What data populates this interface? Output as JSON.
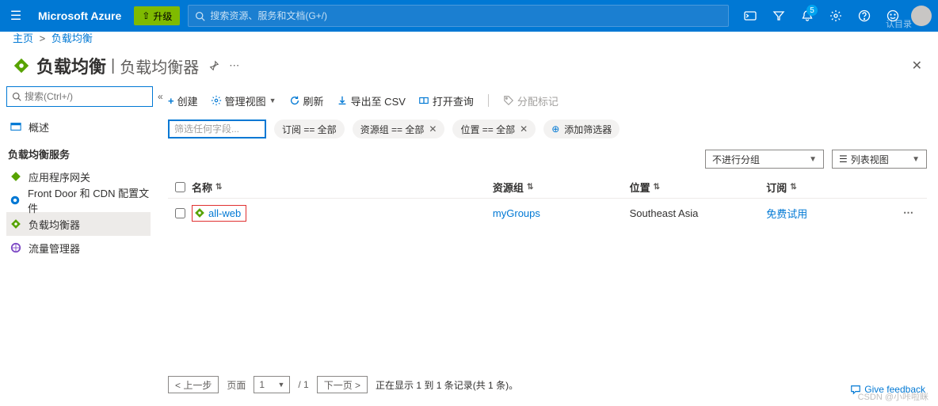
{
  "topbar": {
    "brand": "Microsoft Azure",
    "upgrade": "升级",
    "search_placeholder": "搜索资源、服务和文档(G+/)",
    "notif_count": "5"
  },
  "breadcrumb": {
    "home": "主页",
    "current": "负载均衡"
  },
  "header": {
    "title": "负载均衡",
    "subtitle": "负载均衡器"
  },
  "sidebar": {
    "search_placeholder": "搜索(Ctrl+/)",
    "overview": "概述",
    "section": "负载均衡服务",
    "items": [
      "应用程序网关",
      "Front Door 和 CDN 配置文件",
      "负载均衡器",
      "流量管理器"
    ]
  },
  "toolbar": {
    "create": "创建",
    "manage_view": "管理视图",
    "refresh": "刷新",
    "export_csv": "导出至 CSV",
    "open_query": "打开查询",
    "assign_tags": "分配标记"
  },
  "filters": {
    "input_placeholder": "筛选任何字段...",
    "sub": "订阅 == 全部",
    "rg": "资源组 == 全部",
    "loc": "位置 == 全部",
    "add": "添加筛选器"
  },
  "viewbar": {
    "group": "不进行分组",
    "view": "列表视图"
  },
  "table": {
    "headers": {
      "name": "名称",
      "rg": "资源组",
      "loc": "位置",
      "sub": "订阅"
    },
    "rows": [
      {
        "name": "all-web",
        "rg": "myGroups",
        "loc": "Southeast Asia",
        "sub": "免费试用"
      }
    ]
  },
  "pager": {
    "prev": "< 上一步",
    "page_label": "页面",
    "page": "1",
    "total": "/ 1",
    "next": "下一页 >",
    "summary": "正在显示 1 到 1 条记录(共 1 条)。"
  },
  "feedback": "Give feedback",
  "watermark1": "认目录",
  "watermark2": "CSDN @小咔啦眯"
}
